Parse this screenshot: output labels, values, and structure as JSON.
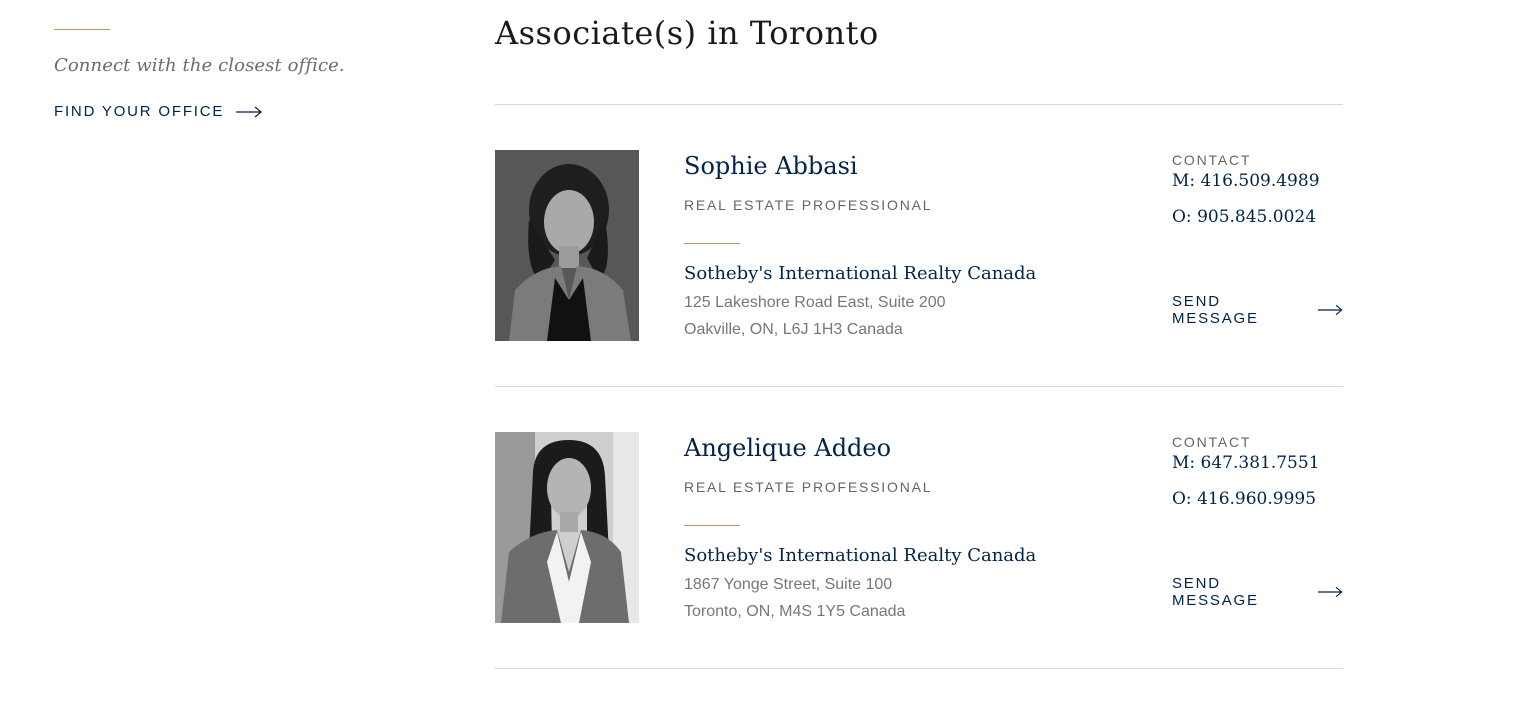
{
  "sidebar": {
    "tagline": "Connect with the closest office.",
    "find_office_label": "FIND YOUR OFFICE"
  },
  "main": {
    "heading": "Associate(s) in Toronto",
    "agents": [
      {
        "name": "Sophie Abbasi",
        "role": "REAL ESTATE PROFESSIONAL",
        "office": "Sotheby's International Realty Canada",
        "address_line1": "125 Lakeshore Road East, Suite 200",
        "address_line2": "Oakville, ON, L6J 1H3 Canada",
        "contact_label": "CONTACT",
        "mobile": "M: 416.509.4989",
        "office_phone": "O: 905.845.0024",
        "send_label": "SEND MESSAGE"
      },
      {
        "name": "Angelique Addeo",
        "role": "REAL ESTATE PROFESSIONAL",
        "office": "Sotheby's International Realty Canada",
        "address_line1": "1867 Yonge Street, Suite 100",
        "address_line2": "Toronto, ON, M4S 1Y5 Canada",
        "contact_label": "CONTACT",
        "mobile": "M: 647.381.7551",
        "office_phone": "O: 416.960.9995",
        "send_label": "SEND MESSAGE"
      }
    ]
  },
  "colors": {
    "navy": "#002349",
    "gold": "#b39a61",
    "gray_text": "#777777",
    "divider": "#d9d9d9"
  },
  "icons": {
    "find_office_arrow": "arrow-right-icon",
    "send_message_arrow": "arrow-right-icon"
  }
}
